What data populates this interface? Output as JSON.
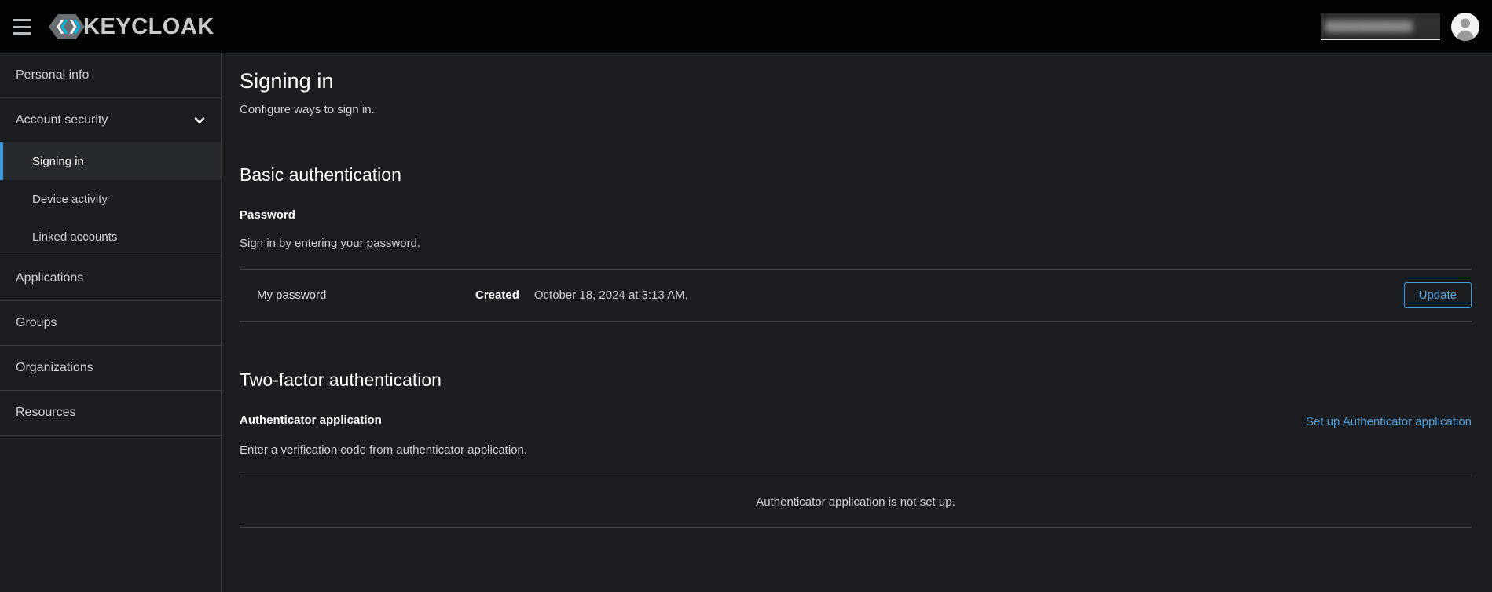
{
  "masthead": {
    "menu_icon": "hamburger-icon",
    "brand_text": "KEYCLOAK",
    "brand_logo_icon": "keycloak-hexagon-logo",
    "user_name_redacted": "████████████",
    "avatar_icon": "user-avatar-icon",
    "brand_accent": "#39a5dc",
    "background": "#030303"
  },
  "sidebar": {
    "items": [
      {
        "label": "Personal info",
        "type": "link"
      },
      {
        "label": "Account security",
        "type": "expandable",
        "expanded": true,
        "chevron_icon": "chevron-down-icon"
      },
      {
        "label": "Signing in",
        "type": "sub",
        "active": true
      },
      {
        "label": "Device activity",
        "type": "sub",
        "active": false
      },
      {
        "label": "Linked accounts",
        "type": "sub",
        "active": false
      },
      {
        "label": "Applications",
        "type": "link"
      },
      {
        "label": "Groups",
        "type": "link"
      },
      {
        "label": "Organizations",
        "type": "link"
      },
      {
        "label": "Resources",
        "type": "link"
      }
    ],
    "active_accent": "#3d9bdd"
  },
  "main": {
    "title": "Signing in",
    "subtitle": "Configure ways to sign in.",
    "basic_auth": {
      "heading": "Basic authentication",
      "credential_title": "Password",
      "credential_help": "Sign in by entering your password.",
      "row": {
        "label": "My password",
        "meta_key": "Created",
        "meta_value": "October 18, 2024 at 3:13 AM.",
        "action_label": "Update"
      }
    },
    "two_factor": {
      "heading": "Two-factor authentication",
      "credential_title": "Authenticator application",
      "credential_help": "Enter a verification code from authenticator application.",
      "setup_link": "Set up Authenticator application",
      "empty_message": "Authenticator application is not set up."
    }
  }
}
